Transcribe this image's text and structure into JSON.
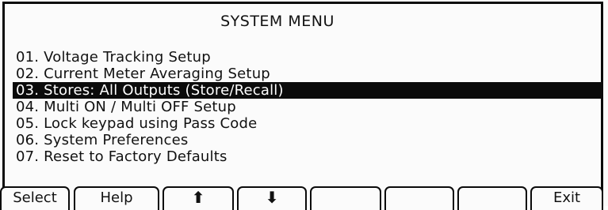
{
  "title": "SYSTEM MENU",
  "menu_items": [
    "01. Voltage Tracking Setup",
    "02. Current Meter Averaging Setup",
    "03. Stores: All Outputs (Store/Recall)",
    "04. Multi ON / Multi OFF Setup",
    "05. Lock keypad using Pass Code",
    "06. System Preferences",
    "07. Reset to Factory Defaults"
  ],
  "selected_index": 2,
  "softkeys": {
    "select": "Select",
    "help": "Help",
    "up": "⬆",
    "down": "⬇",
    "blank1": "",
    "blank2": "",
    "blank3": "",
    "exit": "Exit"
  },
  "icons": {
    "up": "up-arrow-icon",
    "down": "down-arrow-icon"
  }
}
